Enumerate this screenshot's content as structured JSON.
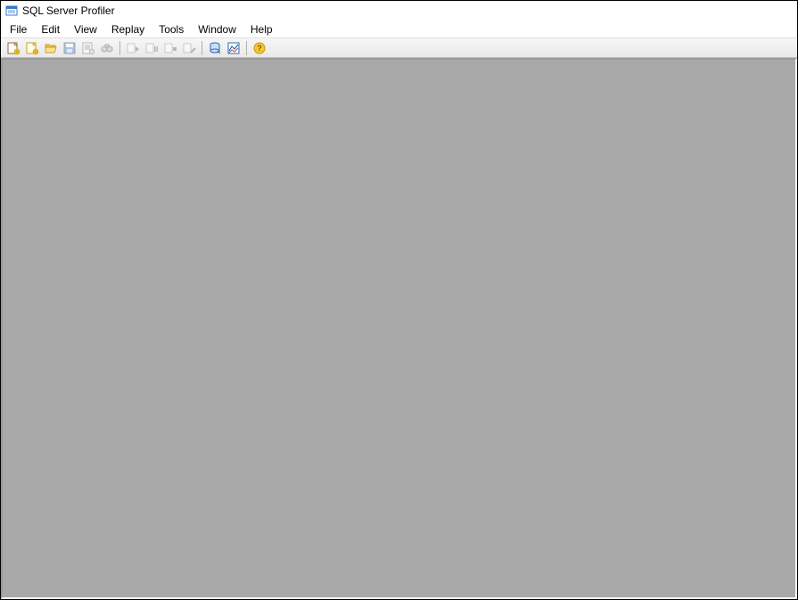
{
  "titlebar": {
    "title": "SQL Server Profiler"
  },
  "menubar": {
    "items": [
      {
        "label": "File"
      },
      {
        "label": "Edit"
      },
      {
        "label": "View"
      },
      {
        "label": "Replay"
      },
      {
        "label": "Tools"
      },
      {
        "label": "Window"
      },
      {
        "label": "Help"
      }
    ]
  },
  "toolbar": {
    "buttons": [
      {
        "name": "new-trace",
        "enabled": true
      },
      {
        "name": "new-template",
        "enabled": true
      },
      {
        "name": "open-file",
        "enabled": true
      },
      {
        "name": "save",
        "enabled": false
      },
      {
        "name": "properties",
        "enabled": false
      },
      {
        "name": "find",
        "enabled": false
      },
      {
        "sep": true
      },
      {
        "name": "start-trace",
        "enabled": false
      },
      {
        "name": "pause-trace",
        "enabled": false
      },
      {
        "name": "stop-trace",
        "enabled": false
      },
      {
        "name": "clear-trace",
        "enabled": false
      },
      {
        "sep": true
      },
      {
        "name": "database-tuning",
        "enabled": true
      },
      {
        "name": "performance-monitor",
        "enabled": true
      },
      {
        "sep": true
      },
      {
        "name": "help",
        "enabled": true
      }
    ]
  }
}
